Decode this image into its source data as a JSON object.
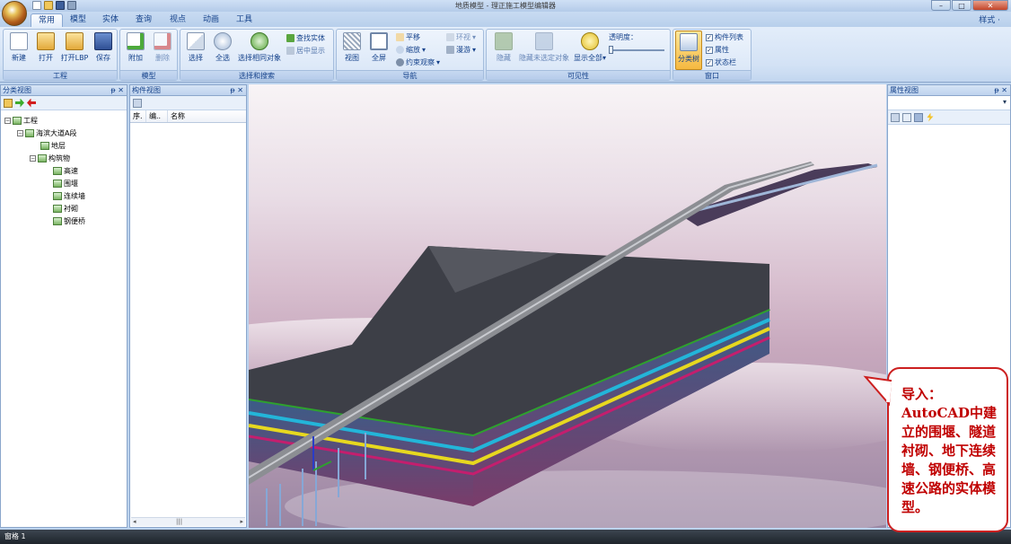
{
  "window": {
    "title": "地质模型 - 理正施工模型编辑器",
    "style_menu": "样式 ·"
  },
  "tabs": [
    {
      "label": "常用",
      "active": true
    },
    {
      "label": "模型"
    },
    {
      "label": "实体"
    },
    {
      "label": "查询"
    },
    {
      "label": "视点"
    },
    {
      "label": "动画"
    },
    {
      "label": "工具"
    }
  ],
  "ribbon": {
    "project": {
      "label": "工程",
      "new": "新建",
      "open": "打开",
      "open_lbp": "打开LBP",
      "save": "保存"
    },
    "model": {
      "label": "模型",
      "attach": "附加",
      "delete": "删除"
    },
    "select": {
      "label": "选择和搜索",
      "select": "选择",
      "select_all": "全选",
      "select_same": "选择相同对象",
      "find_entity": "查找实体",
      "center_show": "居中显示"
    },
    "nav": {
      "label": "导航",
      "view": "视图",
      "fullscreen": "全屏",
      "pan": "平移",
      "zoom": "缩放",
      "constrained": "约束观察",
      "orbit": "环视",
      "roam": "漫游"
    },
    "visibility": {
      "label": "可见性",
      "hide": "隐藏",
      "hide_unselected": "隐藏未选定对象",
      "show_all": "显示全部",
      "transparency": "透明度："
    },
    "window": {
      "label": "窗口",
      "tree": "分类树",
      "component_list": "构件列表",
      "properties": "属性",
      "status": "状态栏"
    }
  },
  "class_panel": {
    "title": "分类视图",
    "tree": [
      {
        "label": "工程",
        "level": 0
      },
      {
        "label": "海滨大道A段",
        "level": 1
      },
      {
        "label": "地层",
        "level": 2
      },
      {
        "label": "构筑物",
        "level": 2
      },
      {
        "label": "高速",
        "level": 3
      },
      {
        "label": "围堰",
        "level": 3
      },
      {
        "label": "连续墙",
        "level": 3
      },
      {
        "label": "衬砌",
        "level": 3
      },
      {
        "label": "钢便桥",
        "level": 3
      }
    ]
  },
  "component_panel": {
    "title": "构件视图",
    "col_no": "序.",
    "col_code": "编..",
    "col_name": "名称",
    "scroll_mark": "|||"
  },
  "property_panel": {
    "title": "属性视图"
  },
  "callout": {
    "line1": "导入：",
    "body": "AutoCAD中建立的围堰、隧道衬砌、地下连续墙、钢便桥、高速公路的实体模型。"
  },
  "status": {
    "text": "窗格 1"
  }
}
